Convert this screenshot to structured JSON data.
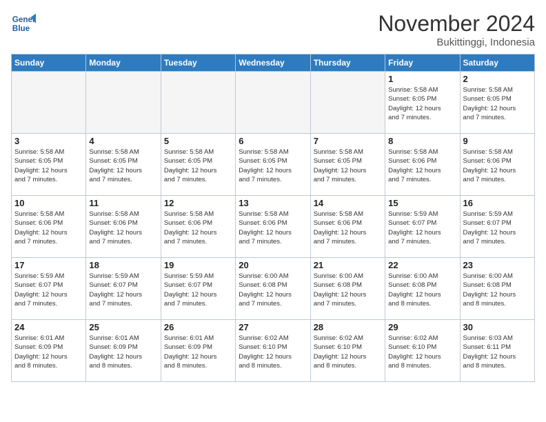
{
  "header": {
    "logo_line1": "General",
    "logo_line2": "Blue",
    "month_title": "November 2024",
    "location": "Bukittinggi, Indonesia"
  },
  "weekdays": [
    "Sunday",
    "Monday",
    "Tuesday",
    "Wednesday",
    "Thursday",
    "Friday",
    "Saturday"
  ],
  "weeks": [
    [
      {
        "day": "",
        "info": ""
      },
      {
        "day": "",
        "info": ""
      },
      {
        "day": "",
        "info": ""
      },
      {
        "day": "",
        "info": ""
      },
      {
        "day": "",
        "info": ""
      },
      {
        "day": "1",
        "info": "Sunrise: 5:58 AM\nSunset: 6:05 PM\nDaylight: 12 hours\nand 7 minutes."
      },
      {
        "day": "2",
        "info": "Sunrise: 5:58 AM\nSunset: 6:05 PM\nDaylight: 12 hours\nand 7 minutes."
      }
    ],
    [
      {
        "day": "3",
        "info": "Sunrise: 5:58 AM\nSunset: 6:05 PM\nDaylight: 12 hours\nand 7 minutes."
      },
      {
        "day": "4",
        "info": "Sunrise: 5:58 AM\nSunset: 6:05 PM\nDaylight: 12 hours\nand 7 minutes."
      },
      {
        "day": "5",
        "info": "Sunrise: 5:58 AM\nSunset: 6:05 PM\nDaylight: 12 hours\nand 7 minutes."
      },
      {
        "day": "6",
        "info": "Sunrise: 5:58 AM\nSunset: 6:05 PM\nDaylight: 12 hours\nand 7 minutes."
      },
      {
        "day": "7",
        "info": "Sunrise: 5:58 AM\nSunset: 6:05 PM\nDaylight: 12 hours\nand 7 minutes."
      },
      {
        "day": "8",
        "info": "Sunrise: 5:58 AM\nSunset: 6:06 PM\nDaylight: 12 hours\nand 7 minutes."
      },
      {
        "day": "9",
        "info": "Sunrise: 5:58 AM\nSunset: 6:06 PM\nDaylight: 12 hours\nand 7 minutes."
      }
    ],
    [
      {
        "day": "10",
        "info": "Sunrise: 5:58 AM\nSunset: 6:06 PM\nDaylight: 12 hours\nand 7 minutes."
      },
      {
        "day": "11",
        "info": "Sunrise: 5:58 AM\nSunset: 6:06 PM\nDaylight: 12 hours\nand 7 minutes."
      },
      {
        "day": "12",
        "info": "Sunrise: 5:58 AM\nSunset: 6:06 PM\nDaylight: 12 hours\nand 7 minutes."
      },
      {
        "day": "13",
        "info": "Sunrise: 5:58 AM\nSunset: 6:06 PM\nDaylight: 12 hours\nand 7 minutes."
      },
      {
        "day": "14",
        "info": "Sunrise: 5:58 AM\nSunset: 6:06 PM\nDaylight: 12 hours\nand 7 minutes."
      },
      {
        "day": "15",
        "info": "Sunrise: 5:59 AM\nSunset: 6:07 PM\nDaylight: 12 hours\nand 7 minutes."
      },
      {
        "day": "16",
        "info": "Sunrise: 5:59 AM\nSunset: 6:07 PM\nDaylight: 12 hours\nand 7 minutes."
      }
    ],
    [
      {
        "day": "17",
        "info": "Sunrise: 5:59 AM\nSunset: 6:07 PM\nDaylight: 12 hours\nand 7 minutes."
      },
      {
        "day": "18",
        "info": "Sunrise: 5:59 AM\nSunset: 6:07 PM\nDaylight: 12 hours\nand 7 minutes."
      },
      {
        "day": "19",
        "info": "Sunrise: 5:59 AM\nSunset: 6:07 PM\nDaylight: 12 hours\nand 7 minutes."
      },
      {
        "day": "20",
        "info": "Sunrise: 6:00 AM\nSunset: 6:08 PM\nDaylight: 12 hours\nand 7 minutes."
      },
      {
        "day": "21",
        "info": "Sunrise: 6:00 AM\nSunset: 6:08 PM\nDaylight: 12 hours\nand 7 minutes."
      },
      {
        "day": "22",
        "info": "Sunrise: 6:00 AM\nSunset: 6:08 PM\nDaylight: 12 hours\nand 8 minutes."
      },
      {
        "day": "23",
        "info": "Sunrise: 6:00 AM\nSunset: 6:08 PM\nDaylight: 12 hours\nand 8 minutes."
      }
    ],
    [
      {
        "day": "24",
        "info": "Sunrise: 6:01 AM\nSunset: 6:09 PM\nDaylight: 12 hours\nand 8 minutes."
      },
      {
        "day": "25",
        "info": "Sunrise: 6:01 AM\nSunset: 6:09 PM\nDaylight: 12 hours\nand 8 minutes."
      },
      {
        "day": "26",
        "info": "Sunrise: 6:01 AM\nSunset: 6:09 PM\nDaylight: 12 hours\nand 8 minutes."
      },
      {
        "day": "27",
        "info": "Sunrise: 6:02 AM\nSunset: 6:10 PM\nDaylight: 12 hours\nand 8 minutes."
      },
      {
        "day": "28",
        "info": "Sunrise: 6:02 AM\nSunset: 6:10 PM\nDaylight: 12 hours\nand 8 minutes."
      },
      {
        "day": "29",
        "info": "Sunrise: 6:02 AM\nSunset: 6:10 PM\nDaylight: 12 hours\nand 8 minutes."
      },
      {
        "day": "30",
        "info": "Sunrise: 6:03 AM\nSunset: 6:11 PM\nDaylight: 12 hours\nand 8 minutes."
      }
    ]
  ]
}
